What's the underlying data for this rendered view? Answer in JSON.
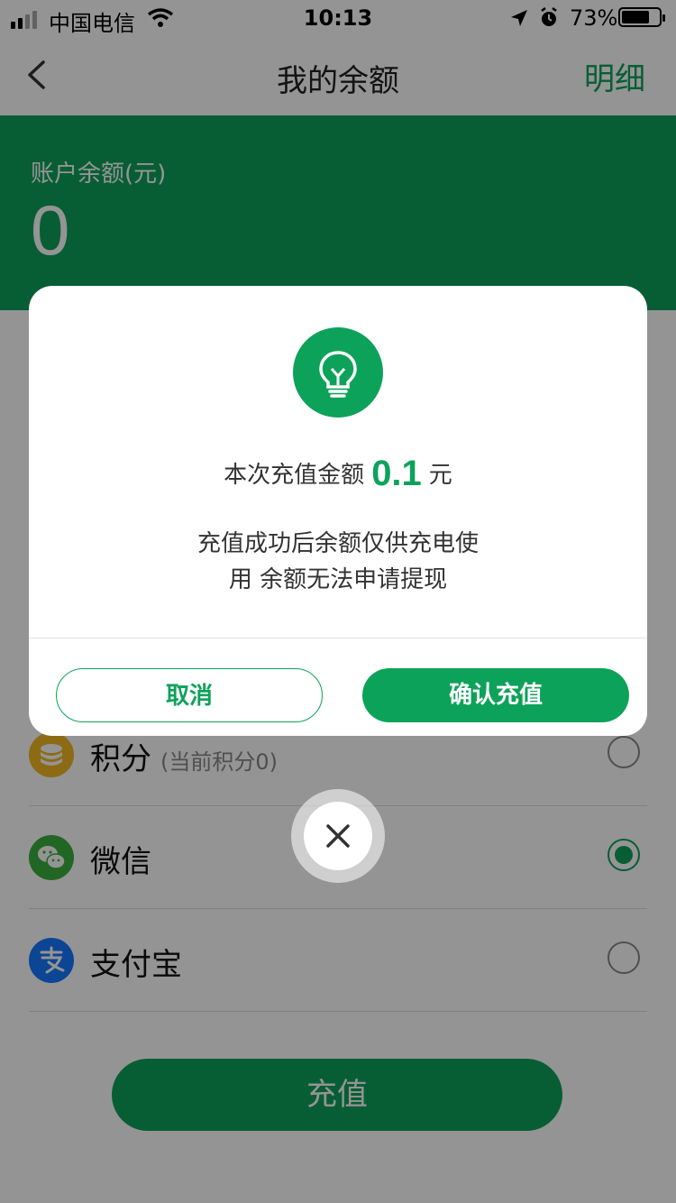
{
  "status_bar": {
    "carrier": "中国电信",
    "time": "10:13",
    "battery": "73%"
  },
  "nav": {
    "title": "我的余额",
    "detail_link": "明细"
  },
  "balance": {
    "label": "账户余额(元)",
    "value": "0"
  },
  "payment_methods": [
    {
      "name": "积分",
      "sub": "(当前积分0)",
      "icon": "points-icon",
      "selected": false
    },
    {
      "name": "微信",
      "sub": "",
      "icon": "wechat-icon",
      "selected": true
    },
    {
      "name": "支付宝",
      "sub": "",
      "icon": "alipay-icon",
      "selected": false
    }
  ],
  "charge_button": "充值",
  "dialog": {
    "amount_prefix": "本次充值金额",
    "amount_value": "0.1",
    "amount_unit": "元",
    "notice_line1": "充值成功后余额仅供充电使",
    "notice_line2": "用 余额无法申请提现",
    "cancel_label": "取消",
    "confirm_label": "确认充值"
  },
  "colors": {
    "brand_green": "#0da25a"
  }
}
